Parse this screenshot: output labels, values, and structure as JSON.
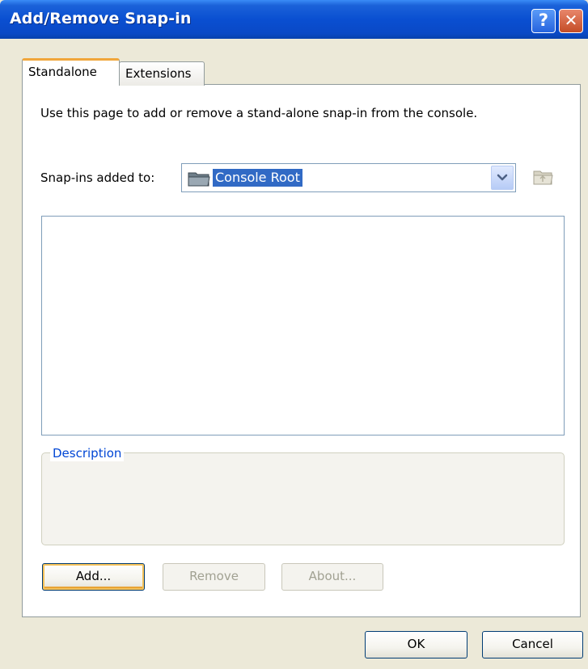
{
  "window": {
    "title": "Add/Remove Snap-in",
    "help_glyph": "?",
    "close_glyph": "✕"
  },
  "tabs": [
    {
      "label": "Standalone",
      "selected": true
    },
    {
      "label": "Extensions",
      "selected": false
    }
  ],
  "standalone": {
    "intro_text": "Use this page to add or remove a stand-alone snap-in from the console.",
    "snapins_added_to_label": "Snap-ins added to:",
    "snapins_added_to_value": "Console Root",
    "snapin_list_items": [],
    "description_legend": "Description",
    "description_text": ""
  },
  "buttons": {
    "add": "Add...",
    "remove": "Remove",
    "about": "About...",
    "ok": "OK",
    "cancel": "Cancel"
  },
  "icons": {
    "folder": "folder-icon",
    "dropdown": "chevron-down-icon",
    "up_folder": "up-folder-icon"
  },
  "colors": {
    "titlebar": "#0a4fd1",
    "selection": "#316ac5",
    "tab_highlight": "#f1a63b",
    "group_legend": "#0046d5"
  }
}
